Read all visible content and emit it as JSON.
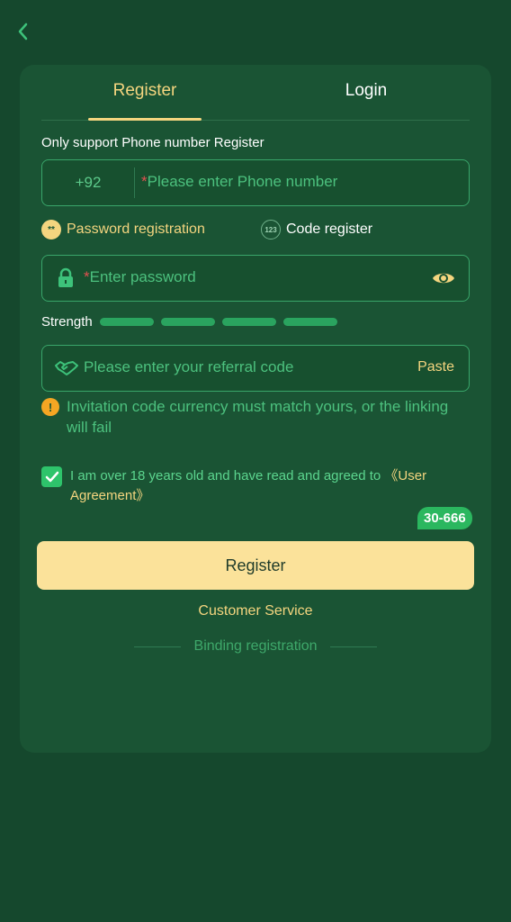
{
  "tabs": {
    "register": "Register",
    "login": "Login"
  },
  "phone": {
    "hint": "Only support Phone number Register",
    "country_code": "+92",
    "required_mark": "*",
    "placeholder": "Please enter Phone number"
  },
  "modes": {
    "password_icon_text": "**",
    "password": "Password registration",
    "code_icon_text": "123",
    "code": "Code register"
  },
  "password": {
    "required_mark": "*",
    "placeholder": "Enter password"
  },
  "strength": {
    "label": "Strength",
    "bars": 4
  },
  "referral": {
    "placeholder": "Please enter your referral code",
    "paste": "Paste"
  },
  "warning": {
    "icon_text": "!",
    "text": "Invitation code currency must match yours, or the linking will fail"
  },
  "agreement": {
    "checked": true,
    "text": "I am over 18 years old and have read and agreed to ",
    "link": "《User Agreement》"
  },
  "badge": "30-666",
  "register_button": "Register",
  "customer_service": "Customer Service",
  "binding_registration": "Binding registration",
  "colors": {
    "background": "#15482d",
    "card": "#1a5434",
    "accent_gold": "#f4d57f",
    "accent_green": "#2ec46b",
    "button": "#fbe29a"
  },
  "icons": [
    "back-arrow-icon",
    "lock-icon",
    "eye-icon",
    "handshake-icon",
    "warning-icon",
    "check-icon"
  ]
}
